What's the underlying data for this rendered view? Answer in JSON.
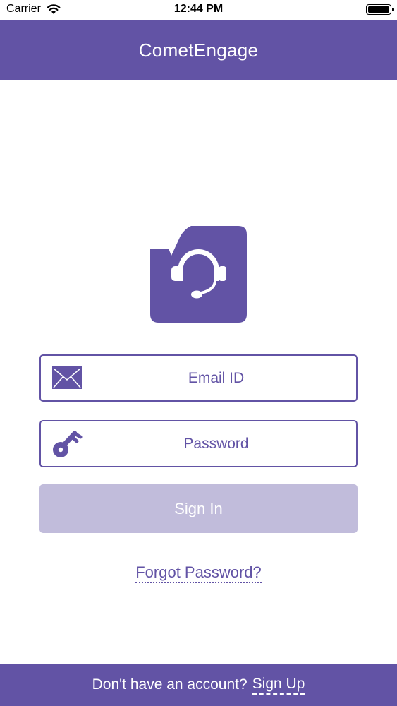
{
  "status_bar": {
    "carrier": "Carrier",
    "time": "12:44 PM"
  },
  "nav": {
    "title": "CometEngage"
  },
  "login": {
    "email_placeholder": "Email ID",
    "password_placeholder": "Password",
    "signin_label": "Sign In",
    "forgot_label": "Forgot Password?"
  },
  "footer": {
    "prompt": "Don't have an account?",
    "signup_label": "Sign Up"
  },
  "colors": {
    "brand": "#6253a5",
    "button_disabled": "#c1bcdb",
    "background": "#ffffff"
  },
  "icons": [
    "wifi-icon",
    "battery-icon",
    "app-logo-headset-icon",
    "envelope-icon",
    "key-icon"
  ]
}
